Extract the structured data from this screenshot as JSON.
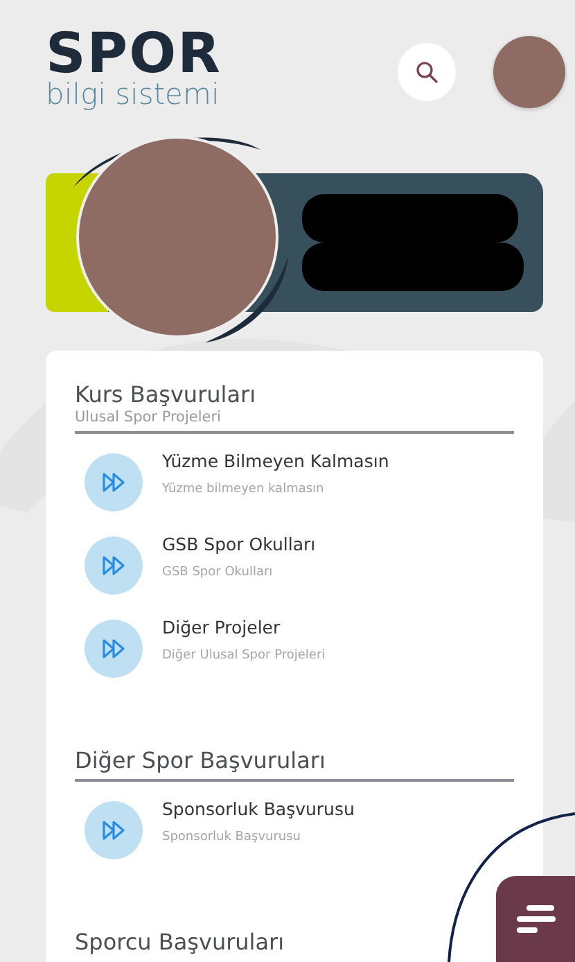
{
  "header": {
    "logo": "SPOR",
    "logo_subtitle": "bilgi sistemi"
  },
  "sections": [
    {
      "title": "Kurs Başvuruları",
      "subtitle": "Ulusal Spor Projeleri",
      "items": [
        {
          "title": "Yüzme Bilmeyen Kalmasın",
          "subtitle": "Yüzme bilmeyen kalmasın"
        },
        {
          "title": "GSB Spor Okulları",
          "subtitle": "GSB Spor Okulları"
        },
        {
          "title": "Diğer Projeler",
          "subtitle": "Diğer Ulusal Spor Projeleri"
        }
      ]
    },
    {
      "title": "Diğer Spor Başvuruları",
      "items": [
        {
          "title": "Sponsorluk Başvurusu",
          "subtitle": "Sponsorluk Başvurusu"
        }
      ]
    },
    {
      "title": "Sporcu Başvuruları"
    }
  ]
}
